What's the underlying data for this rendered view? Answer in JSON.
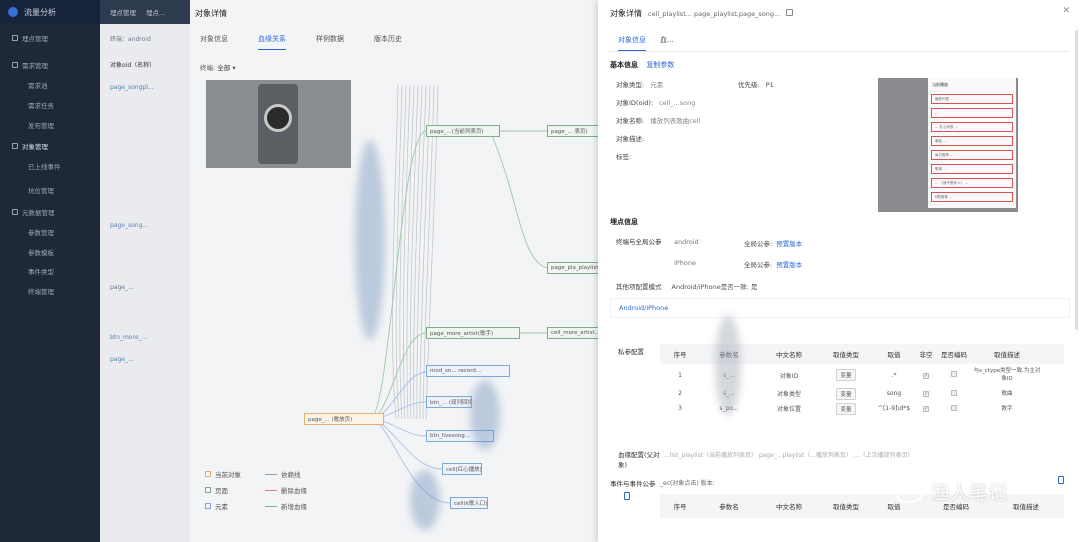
{
  "app": {
    "brand": "流量分析",
    "top_nav": [
      "埋点管理",
      "埋点..."
    ]
  },
  "sidebar": {
    "items": [
      {
        "label": "埋点管理",
        "level": 0
      },
      {
        "label": "需求管理",
        "level": 1
      },
      {
        "label": "需求池",
        "level": 2
      },
      {
        "label": "需求任务",
        "level": 2
      },
      {
        "label": "发布管理",
        "level": 2
      },
      {
        "label": "对象管理",
        "level": 1,
        "active": true
      },
      {
        "label": "已上线事件",
        "level": 2
      },
      {
        "label": "坑位管理",
        "level": 2
      },
      {
        "label": "元数据管理",
        "level": 1
      },
      {
        "label": "参数管理",
        "level": 2
      },
      {
        "label": "参数模板",
        "level": 2
      },
      {
        "label": "事件类型",
        "level": 2
      },
      {
        "label": "终端管理",
        "level": 2
      }
    ]
  },
  "list_page": {
    "filter": "终端：android",
    "column": "对象oid（名称）",
    "rows": [
      "page_songpl...",
      "page_song...",
      "page_...",
      "btn_more_...",
      "page_..."
    ]
  },
  "lineage_drawer": {
    "title": "对象详情",
    "tabs": [
      "对象信息",
      "血缘关系",
      "样例数据",
      "版本历史"
    ],
    "active_tab": "血缘关系",
    "filter_label": "终端:",
    "filter_value": "全部",
    "nodes": [
      {
        "label": "page_...(当前列表页)",
        "kind": "green"
      },
      {
        "label": "page_... 表页)",
        "kind": "green"
      },
      {
        "label": "page_pla_playlist...",
        "kind": "green"
      },
      {
        "label": "page_more_artist(歌手)",
        "kind": "green"
      },
      {
        "label": "cell_more_artist...",
        "kind": "green"
      },
      {
        "label": "mod_sn... record...",
        "kind": "blue"
      },
      {
        "label": "btn_... (双列回切)",
        "kind": "blue"
      },
      {
        "label": "btn_livesong...",
        "kind": "blue"
      },
      {
        "label": "cell(红心播放)",
        "kind": "blue"
      },
      {
        "label": "cell(k歌入口)",
        "kind": "blue"
      },
      {
        "label": "page_... (歌放页)",
        "kind": "orange"
      }
    ],
    "legend": [
      {
        "label": "当前对象",
        "type": "box",
        "color": "#e4b170"
      },
      {
        "label": "依赖线",
        "type": "line",
        "color": "#9aa0a8"
      },
      {
        "label": "页面",
        "type": "box",
        "color": "#7fae8c"
      },
      {
        "label": "删除血缘",
        "type": "line",
        "color": "#e07b7b"
      },
      {
        "label": "元素",
        "type": "box",
        "color": "#7ea6d8"
      },
      {
        "label": "新增血缘",
        "type": "line",
        "color": "#6cc08a"
      }
    ]
  },
  "detail": {
    "title": "对象详情",
    "subtitle": "cell_playlist... page_playlist,page_song...",
    "tabs": [
      "对象信息",
      "血..."
    ],
    "active_tab": "对象信息",
    "basic": {
      "section": "基本信息",
      "link": "复制参数",
      "type_label": "对象类型:",
      "type_value": "元素",
      "priority_label": "优先级:",
      "priority_value": "P1",
      "oid_label": "对象ID(oid):",
      "oid_value": "cell_...song",
      "name_label": "对象名称:",
      "name_value": "播放列表歌曲cell",
      "desc_label": "对象描述:",
      "tag_label": "标签:"
    },
    "preview": {
      "header": "当前播放",
      "rows": [
        "播放列表 ...",
        "...",
        "... 红心列表 ...",
        "单曲 ...",
        "每日推荐 ...",
        "歌单 ...",
        "... 《我不是你人》 ...",
        "K歌推荐 ..."
      ]
    },
    "tracking": {
      "section": "埋点信息",
      "platform_label": "终端与全局公参",
      "platforms": [
        {
          "name": "android",
          "param": "全局公参:",
          "link": "预置版本"
        },
        {
          "name": "iPhone",
          "param": "全局公参:",
          "link": "预置版本"
        }
      ],
      "other_label": "其他项配置模式",
      "other_value": "Android/iPhone是否一致: 是"
    },
    "subtab": "Android/iPhone",
    "private_params": {
      "label": "私参配置",
      "columns": [
        "序号",
        "参数名",
        "中文名称",
        "取值类型",
        "取值",
        "非空",
        "是否编码",
        "取值描述"
      ],
      "rows": [
        [
          "1",
          "s_...",
          "对象ID",
          "变量",
          ".*",
          "on",
          "off",
          "与s_ctype类型一致,为主对象ID"
        ],
        [
          "2",
          "s_...",
          "对象类型",
          "变量",
          "song",
          "on",
          "off",
          "歌曲"
        ],
        [
          "3",
          "s_po...",
          "对象位置",
          "变量",
          "^[1-9]\\d*$",
          "on",
          "off",
          "数字"
        ]
      ]
    },
    "lineage_config": {
      "label": "血缘配置(父对象)",
      "value": "...list_playlist（当前播放列表页） page_...playlist（...播放列表页） ...（上次播放列表页）"
    },
    "event_params": {
      "label": "事件与事件公参",
      "value": "_ec(对象点击)   版本:",
      "columns": [
        "序号",
        "参数名",
        "中文名称",
        "取值类型",
        "取值",
        "是否编码",
        "取值描述"
      ]
    }
  },
  "watermark": "渔人笔记"
}
